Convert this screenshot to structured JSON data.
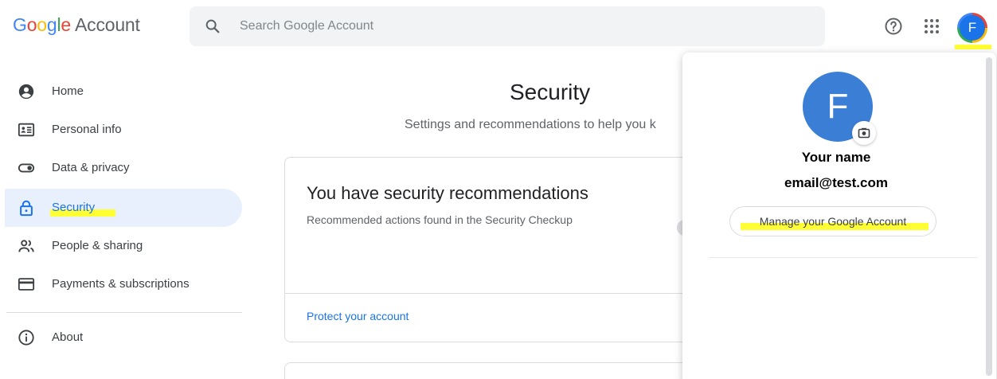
{
  "header": {
    "logo_word": "Google",
    "logo_suffix": "Account",
    "search_placeholder": "Search Google Account",
    "avatar_initial": "F"
  },
  "sidebar": {
    "items": [
      {
        "label": "Home",
        "icon": "account-circle-icon",
        "active": false
      },
      {
        "label": "Personal info",
        "icon": "id-card-icon",
        "active": false
      },
      {
        "label": "Data & privacy",
        "icon": "toggle-icon",
        "active": false
      },
      {
        "label": "Security",
        "icon": "lock-icon",
        "active": true
      },
      {
        "label": "People & sharing",
        "icon": "people-icon",
        "active": false
      },
      {
        "label": "Payments & subscriptions",
        "icon": "credit-card-icon",
        "active": false
      },
      {
        "label": "About",
        "icon": "info-icon",
        "active": false
      }
    ]
  },
  "main": {
    "title": "Security",
    "subtitle": "Settings and recommendations to help you k",
    "card": {
      "title": "You have security recommendations",
      "description": "Recommended actions found in the Security Checkup",
      "link": "Protect your account"
    }
  },
  "popup": {
    "avatar_initial": "F",
    "name": "Your name",
    "email": "email@test.com",
    "manage_button": "Manage your Google Account"
  },
  "colors": {
    "accent": "#1a73e8",
    "active_nav_bg": "#e8f0fe",
    "highlight": "#ffff33",
    "avatar_bg": "#3b7ed6"
  }
}
